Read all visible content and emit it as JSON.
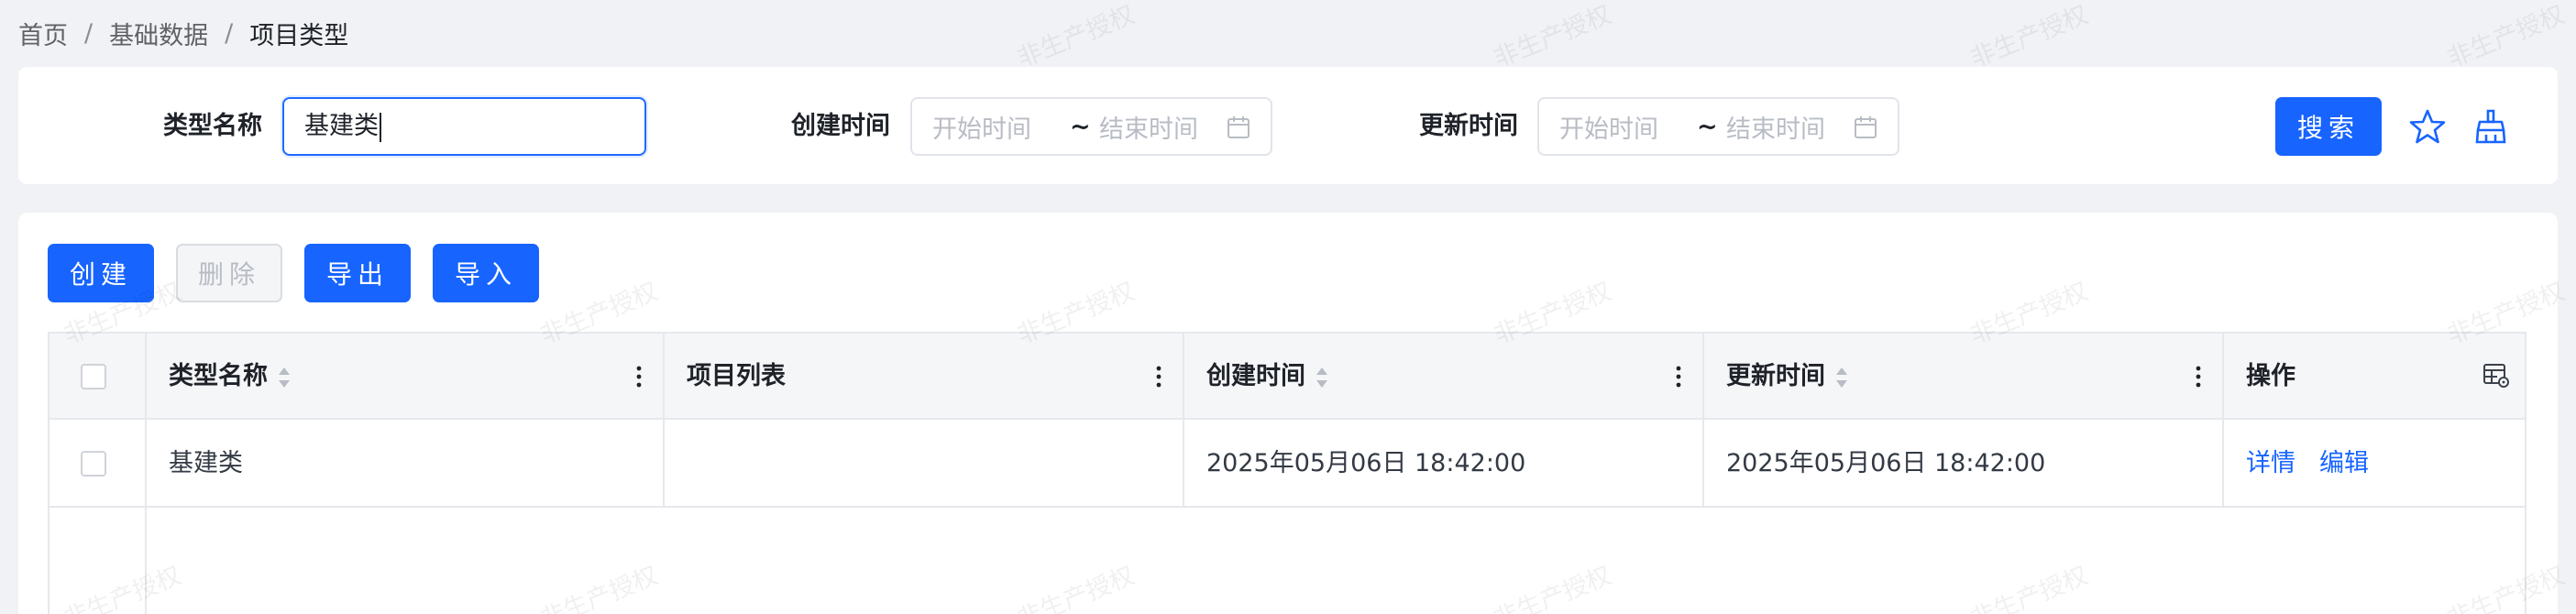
{
  "breadcrumb": {
    "items": [
      "首页",
      "基础数据",
      "项目类型"
    ],
    "separator": "/"
  },
  "search": {
    "type_name_label": "类型名称",
    "type_name_value": "基建类",
    "created_label": "创建时间",
    "updated_label": "更新时间",
    "range_start_placeholder": "开始时间",
    "range_sep": "~",
    "range_end_placeholder": "结束时间",
    "search_button": "搜索"
  },
  "toolbar": {
    "create": "创建",
    "delete": "删除",
    "export": "导出",
    "import": "导入"
  },
  "table": {
    "columns": [
      "类型名称",
      "项目列表",
      "创建时间",
      "更新时间",
      "操作"
    ],
    "rows": [
      {
        "type_name": "基建类",
        "project_list": "",
        "created": "2025年05月06日 18:42:00",
        "updated": "2025年05月06日 18:42:00"
      }
    ],
    "actions": {
      "detail": "详情",
      "edit": "编辑"
    }
  },
  "watermark": "非生产授权",
  "colors": {
    "primary": "#1764ff",
    "background": "#f0f2f5",
    "disabled_text": "#b8bcc4"
  },
  "icons": [
    "calendar-icon",
    "star-icon",
    "broom-icon",
    "sort-icon",
    "more-vertical-icon",
    "table-settings-icon"
  ]
}
